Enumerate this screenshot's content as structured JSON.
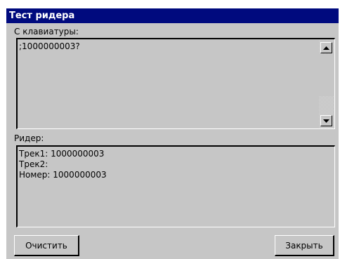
{
  "window": {
    "title": "Тест ридера"
  },
  "keyboard": {
    "label": "С клавиатуры:",
    "value": ";1000000003?"
  },
  "reader": {
    "label": "Ридер:",
    "lines": [
      "Трек1: 1000000003",
      "Трек2:",
      "Номер: 1000000003"
    ]
  },
  "buttons": {
    "clear_label": "Очистить",
    "close_label": "Закрыть"
  },
  "icons": {
    "scroll_up": "triangle-up-icon",
    "scroll_down": "triangle-down-icon"
  },
  "colors": {
    "titlebar": "#000a7e",
    "panel": "#c6c6c6"
  }
}
